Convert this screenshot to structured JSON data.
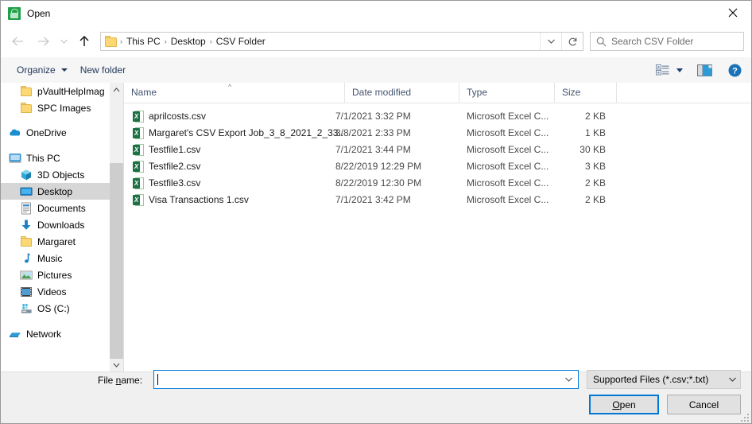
{
  "window": {
    "title": "Open",
    "app_icon": "vault-app-icon",
    "close_label": "×"
  },
  "navbar": {
    "back_icon": "back-arrow-icon",
    "forward_icon": "forward-arrow-icon",
    "recent_icon": "recent-locations-chevron-icon",
    "up_icon": "up-arrow-icon",
    "breadcrumbs": [
      "This PC",
      "Desktop",
      "CSV Folder"
    ],
    "separator": "›",
    "dropdown_icon": "chevron-down-icon",
    "refresh_icon": "refresh-icon",
    "search_placeholder": "Search CSV Folder",
    "search_icon": "search-icon"
  },
  "command_bar": {
    "organize": "Organize",
    "new_folder": "New folder",
    "view_icon": "view-layout-icon",
    "pane_icon": "preview-pane-icon",
    "help_icon": "help-icon"
  },
  "nav_pane": {
    "items": [
      {
        "label": "pVaultHelpImag",
        "icon": "folder-icon",
        "depth": 3,
        "selected": false
      },
      {
        "label": "SPC Images",
        "icon": "folder-icon",
        "depth": 3,
        "selected": false
      },
      {
        "label": "OneDrive",
        "icon": "onedrive-icon",
        "depth": 2,
        "selected": false
      },
      {
        "label": "This PC",
        "icon": "this-pc-icon",
        "depth": 2,
        "selected": false
      },
      {
        "label": "3D Objects",
        "icon": "3d-objects-icon",
        "depth": 3,
        "selected": false
      },
      {
        "label": "Desktop",
        "icon": "desktop-icon",
        "depth": 3,
        "selected": true
      },
      {
        "label": "Documents",
        "icon": "documents-icon",
        "depth": 3,
        "selected": false
      },
      {
        "label": "Downloads",
        "icon": "downloads-icon",
        "depth": 3,
        "selected": false
      },
      {
        "label": "Margaret",
        "icon": "folder-icon",
        "depth": 3,
        "selected": false
      },
      {
        "label": "Music",
        "icon": "music-icon",
        "depth": 3,
        "selected": false
      },
      {
        "label": "Pictures",
        "icon": "pictures-icon",
        "depth": 3,
        "selected": false
      },
      {
        "label": "Videos",
        "icon": "videos-icon",
        "depth": 3,
        "selected": false
      },
      {
        "label": "OS (C:)",
        "icon": "drive-icon",
        "depth": 3,
        "selected": false
      },
      {
        "label": "Network",
        "icon": "network-icon",
        "depth": 2,
        "selected": false
      }
    ],
    "scroll_up_icon": "scroll-up-icon",
    "scroll_down_icon": "scroll-down-icon"
  },
  "file_list": {
    "columns": [
      {
        "label": "Name",
        "sorted": true,
        "sort_indicator": "^"
      },
      {
        "label": "Date modified",
        "sorted": false
      },
      {
        "label": "Type",
        "sorted": false
      },
      {
        "label": "Size",
        "sorted": false
      }
    ],
    "rows": [
      {
        "name": "aprilcosts.csv",
        "date": "7/1/2021 3:32 PM",
        "type": "Microsoft Excel C...",
        "size": "2 KB",
        "icon": "excel-csv-icon"
      },
      {
        "name": "Margaret's CSV Export Job_3_8_2021_2_33...",
        "date": "3/8/2021 2:33 PM",
        "type": "Microsoft Excel C...",
        "size": "1 KB",
        "icon": "excel-csv-icon"
      },
      {
        "name": "Testfile1.csv",
        "date": "7/1/2021 3:44 PM",
        "type": "Microsoft Excel C...",
        "size": "30 KB",
        "icon": "excel-csv-icon"
      },
      {
        "name": "Testfile2.csv",
        "date": "8/22/2019 12:29 PM",
        "type": "Microsoft Excel C...",
        "size": "3 KB",
        "icon": "excel-csv-icon"
      },
      {
        "name": "Testfile3.csv",
        "date": "8/22/2019 12:30 PM",
        "type": "Microsoft Excel C...",
        "size": "2 KB",
        "icon": "excel-csv-icon"
      },
      {
        "name": "Visa Transactions 1.csv",
        "date": "7/1/2021 3:42 PM",
        "type": "Microsoft Excel C...",
        "size": "2 KB",
        "icon": "excel-csv-icon"
      }
    ]
  },
  "footer": {
    "filename_label_pre": "File ",
    "filename_label_accel": "n",
    "filename_label_post": "ame:",
    "filename_value": "",
    "filename_placeholder": "",
    "filetype_value": "Supported Files (*.csv;*.txt)",
    "open_label_accel": "O",
    "open_label_post": "pen",
    "cancel_label": "Cancel"
  },
  "colors": {
    "accent": "#0078d7",
    "header_text": "#44546f",
    "selection": "#d6d6d6",
    "excel_green": "#1d7145",
    "folder_yellow": "#fbd874"
  }
}
